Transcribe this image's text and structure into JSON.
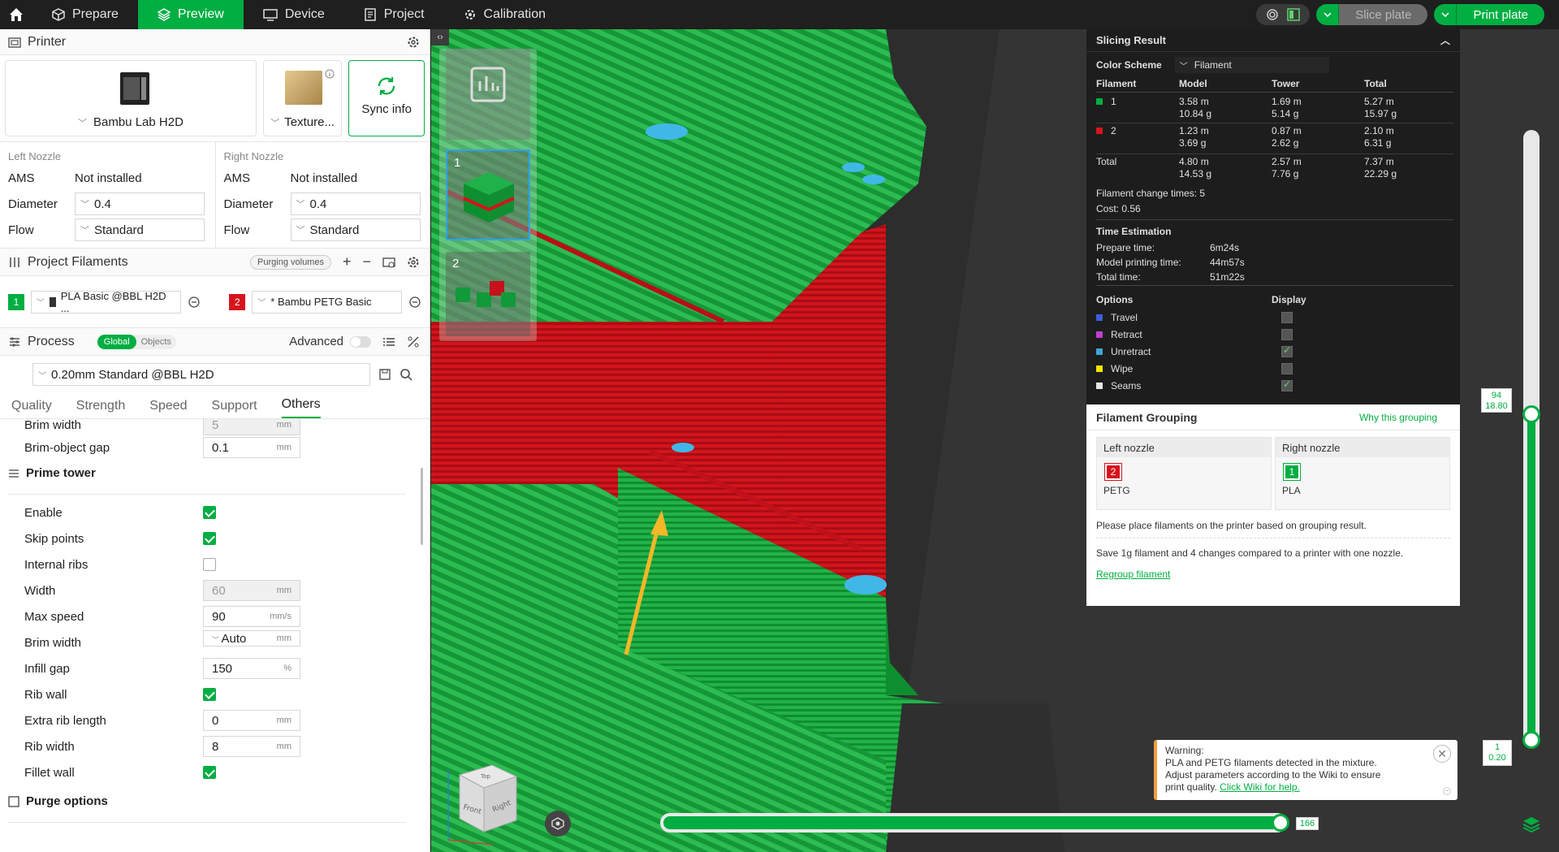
{
  "topbar": {
    "tabs": [
      "Prepare",
      "Preview",
      "Device",
      "Project",
      "Calibration"
    ],
    "slice_label": "Slice plate",
    "print_label": "Print plate"
  },
  "printer": {
    "section": "Printer",
    "model": "Bambu Lab H2D",
    "plate": "Texture...",
    "sync": "Sync info",
    "left_nozzle": {
      "title": "Left Nozzle",
      "ams_label": "AMS",
      "ams_value": "Not installed",
      "diameter_label": "Diameter",
      "diameter": "0.4",
      "flow_label": "Flow",
      "flow": "Standard"
    },
    "right_nozzle": {
      "title": "Right Nozzle",
      "ams_label": "AMS",
      "ams_value": "Not installed",
      "diameter_label": "Diameter",
      "diameter": "0.4",
      "flow_label": "Flow",
      "flow": "Standard"
    }
  },
  "filaments": {
    "section": "Project Filaments",
    "purging": "Purging volumes",
    "items": [
      {
        "num": "1",
        "name": "PLA Basic @BBL H2D ...",
        "color": "#00ae42"
      },
      {
        "num": "2",
        "name": "* Bambu PETG Basic",
        "color": "#d7141d"
      }
    ]
  },
  "process": {
    "section": "Process",
    "global": "Global",
    "objects": "Objects",
    "advanced": "Advanced",
    "preset": "0.20mm Standard @BBL H2D",
    "tabs": [
      "Quality",
      "Strength",
      "Speed",
      "Support",
      "Others"
    ],
    "params": {
      "brim_width_top": {
        "label": "Brim width",
        "value": "5",
        "unit": "mm"
      },
      "brim_object_gap": {
        "label": "Brim-object gap",
        "value": "0.1",
        "unit": "mm"
      },
      "prime_tower": "Prime tower",
      "enable": "Enable",
      "skip_points": "Skip points",
      "internal_ribs": "Internal ribs",
      "width": {
        "label": "Width",
        "value": "60",
        "unit": "mm"
      },
      "max_speed": {
        "label": "Max speed",
        "value": "90",
        "unit": "mm/s"
      },
      "brim_width": {
        "label": "Brim width",
        "value": "Auto",
        "unit": "mm"
      },
      "infill_gap": {
        "label": "Infill gap",
        "value": "150",
        "unit": "%"
      },
      "rib_wall": "Rib wall",
      "extra_rib_length": {
        "label": "Extra rib length",
        "value": "0",
        "unit": "mm"
      },
      "rib_width": {
        "label": "Rib width",
        "value": "8",
        "unit": "mm"
      },
      "fillet_wall": "Fillet wall",
      "purge_options": "Purge options"
    }
  },
  "result": {
    "title": "Slicing Result",
    "color_scheme_label": "Color Scheme",
    "color_scheme": "Filament",
    "headers": [
      "Filament",
      "Model",
      "Tower",
      "Total"
    ],
    "rows": [
      {
        "name": "1",
        "color": "#00ae42",
        "model": [
          "3.58 m",
          "10.84 g"
        ],
        "tower": [
          "1.69 m",
          "5.14 g"
        ],
        "total": [
          "5.27 m",
          "15.97 g"
        ]
      },
      {
        "name": "2",
        "color": "#d7141d",
        "model": [
          "1.23 m",
          "3.69 g"
        ],
        "tower": [
          "0.87 m",
          "2.62 g"
        ],
        "total": [
          "2.10 m",
          "6.31 g"
        ]
      }
    ],
    "total": {
      "name": "Total",
      "model": [
        "4.80 m",
        "14.53 g"
      ],
      "tower": [
        "2.57 m",
        "7.76 g"
      ],
      "total": [
        "7.37 m",
        "22.29 g"
      ]
    },
    "change_times": "Filament change times:  5",
    "cost": "Cost:  0.56",
    "time_title": "Time Estimation",
    "prepare_label": "Prepare time:",
    "prepare": "6m24s",
    "model_time_label": "Model printing time:",
    "model_time": "44m57s",
    "total_time_label": "Total time:",
    "total_time": "51m22s",
    "options_label": "Options",
    "display_label": "Display",
    "options": [
      {
        "name": "Travel",
        "color": "#3b5fd9",
        "on": false
      },
      {
        "name": "Retract",
        "color": "#c03fd0",
        "on": false
      },
      {
        "name": "Unretract",
        "color": "#3fa6d6",
        "on": true
      },
      {
        "name": "Wipe",
        "color": "#f3e600",
        "on": false
      },
      {
        "name": "Seams",
        "color": "#e8e8e8",
        "on": true
      }
    ]
  },
  "grouping": {
    "title": "Filament Grouping",
    "why": "Why this grouping",
    "left": {
      "title": "Left nozzle",
      "num": "2",
      "name": "PETG",
      "color": "#d7141d"
    },
    "right": {
      "title": "Right nozzle",
      "num": "1",
      "name": "PLA",
      "color": "#00ae42"
    },
    "msg1": "Please place filaments on the printer based on grouping result.",
    "msg2": "Save 1g filament and 4 changes compared to a printer with one nozzle.",
    "regroup": "Regroup filament"
  },
  "warning": {
    "title": "Warning:",
    "line1": "PLA and PETG filaments detected in the mixture.",
    "line2": "Adjust parameters according to the Wiki to ensure",
    "line3": "print quality.",
    "link": "Click Wiki for help."
  },
  "slider": {
    "top_layer": "94",
    "top_height": "18.80",
    "bottom_layer": "1",
    "bottom_height": "0.20",
    "h_value": "166"
  },
  "view_cube": {
    "top": "Top",
    "front": "Front",
    "right": "Right"
  },
  "plates": [
    "1",
    "2"
  ]
}
